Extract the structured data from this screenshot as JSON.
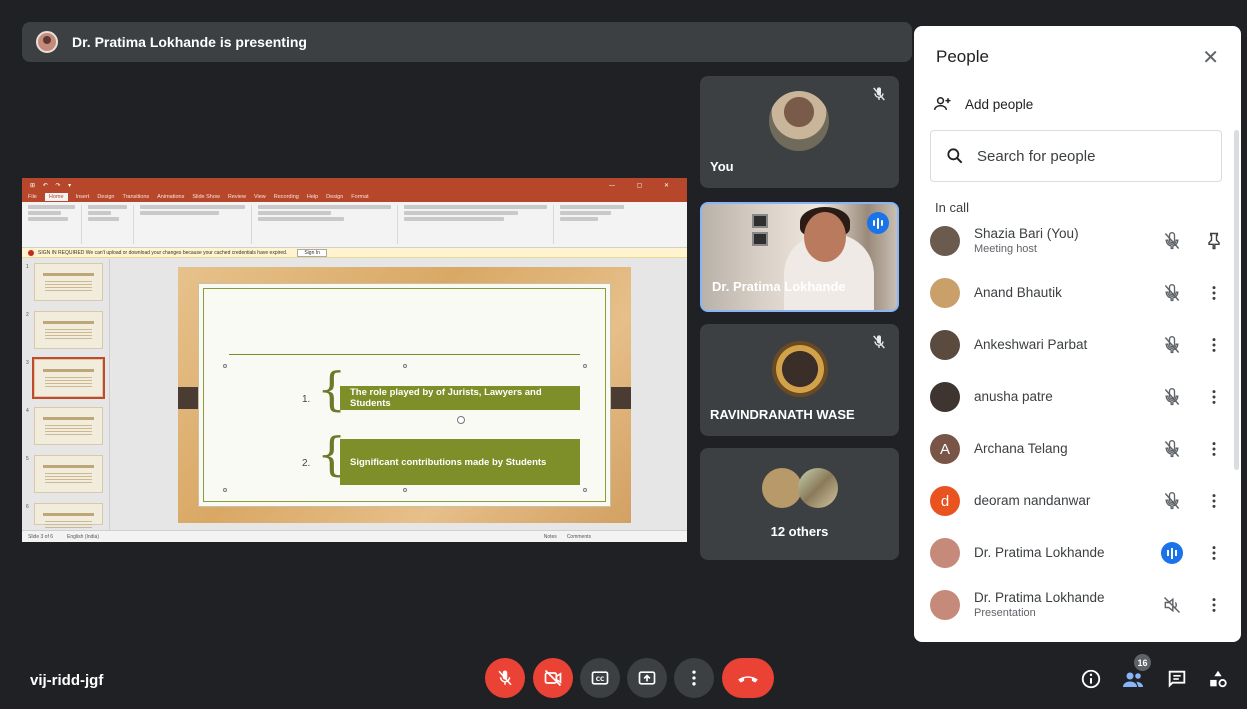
{
  "banner": {
    "presenting_text": "Dr. Pratima Lokhande is presenting"
  },
  "presentation": {
    "slide_points": [
      {
        "number": "1.",
        "text": "The role played by of Jurists, Lawyers and Students"
      },
      {
        "number": "2.",
        "text": "Significant contributions made by Students"
      }
    ],
    "warning_text": "SIGN IN REQUIRED  We can't upload or download your changes because your cached credentials have expired.",
    "warning_button": "Sign In",
    "status_left": "Slide 3 of 6",
    "status_mid": "English (India)",
    "status_notes": "Notes",
    "status_comments": "Comments",
    "ppt_tabs": [
      "File",
      "Home",
      "Insert",
      "Design",
      "Transitions",
      "Animations",
      "Slide Show",
      "Review",
      "View",
      "Recording",
      "Help",
      "Design",
      "Format"
    ]
  },
  "tiles": [
    {
      "name": "You",
      "muted": true
    },
    {
      "name": "Dr. Pratima Lokhande",
      "speaking": true
    },
    {
      "name": "RAVINDRANATH WASE",
      "muted": true
    },
    {
      "name": "12 others"
    }
  ],
  "people_panel": {
    "title": "People",
    "add_people": "Add people",
    "search_placeholder": "Search for people",
    "section": "In call",
    "participants": [
      {
        "name": "Shazia Bari (You)",
        "sub": "Meeting host",
        "mic": "muted",
        "action": "pin",
        "avatar_color": "#6b5a4e",
        "initial": ""
      },
      {
        "name": "Anand Bhautik",
        "sub": "",
        "mic": "muted",
        "action": "more",
        "avatar_color": "#c9a06a",
        "initial": ""
      },
      {
        "name": "Ankeshwari Parbat",
        "sub": "",
        "mic": "muted",
        "action": "more",
        "avatar_color": "#5b4a3e",
        "initial": ""
      },
      {
        "name": "anusha patre",
        "sub": "",
        "mic": "muted",
        "action": "more",
        "avatar_color": "#3e3430",
        "initial": ""
      },
      {
        "name": "Archana Telang",
        "sub": "",
        "mic": "muted",
        "action": "more",
        "avatar_color": "#795548",
        "initial": "A"
      },
      {
        "name": "deoram nandanwar",
        "sub": "",
        "mic": "muted",
        "action": "more",
        "avatar_color": "#e8531f",
        "initial": "d"
      },
      {
        "name": "Dr. Pratima Lokhande",
        "sub": "",
        "mic": "speaking",
        "action": "more",
        "avatar_color": "#c58a7a",
        "initial": ""
      },
      {
        "name": "Dr. Pratima Lokhande",
        "sub": "Presentation",
        "mic": "presentation",
        "action": "more",
        "avatar_color": "#c58a7a",
        "initial": ""
      }
    ]
  },
  "bottom_bar": {
    "meeting_code": "vij-ridd-jgf",
    "participant_count": "16"
  },
  "colors": {
    "background": "#202124",
    "tile": "#3c4043",
    "danger": "#ea4335",
    "accent": "#1a73e8"
  }
}
